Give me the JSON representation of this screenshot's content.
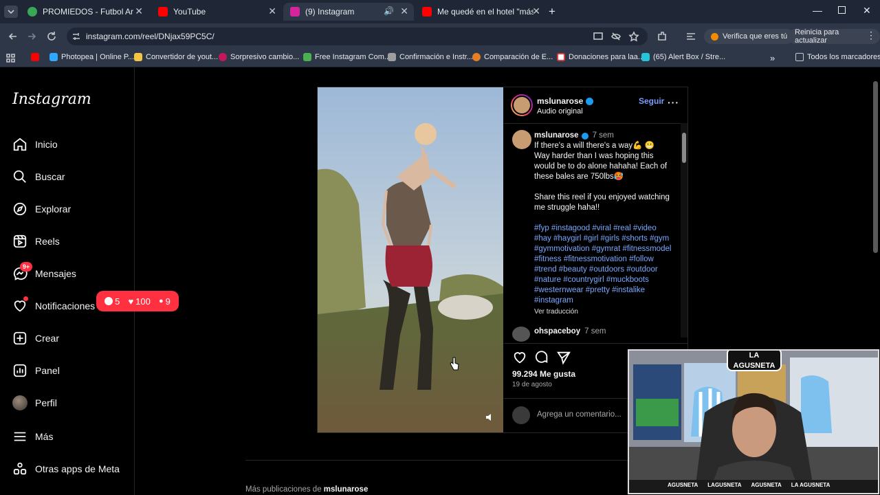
{
  "tabs": [
    {
      "title": "PROMIEDOS - Futbol Argentino",
      "color": "#3aa757"
    },
    {
      "title": "YouTube",
      "color": "#ff0000"
    },
    {
      "title": "(9) Instagram",
      "color": "#d6249f"
    },
    {
      "title": "Me quedé en el hotel \"más lujo",
      "color": "#ff0000"
    }
  ],
  "url": "instagram.com/reel/DNjax59PC5C/",
  "toolbar": {
    "verify": "Verifica que eres tú",
    "reload": "Reinicia para actualizar"
  },
  "bookmarks": [
    "Photopea | Online P...",
    "Convertidor de yout...",
    "Sorpresivo cambio...",
    "Free Instagram Com...",
    "Confirmación e Instr...",
    "Comparación de E...",
    "Donaciones para laa...",
    "(65) Alert Box / Stre..."
  ],
  "bookmarks_all": "Todos los marcadores",
  "nav": {
    "logo": "Instagram",
    "items": [
      "Inicio",
      "Buscar",
      "Explorar",
      "Reels",
      "Mensajes",
      "Notificaciones",
      "Crear",
      "Panel",
      "Perfil",
      "Más",
      "Otras apps de Meta"
    ],
    "messages_badge": "9+",
    "notif": {
      "comments": "5",
      "likes": "100",
      "follows": "9"
    }
  },
  "post": {
    "username": "mslunarose",
    "audio": "Audio original",
    "follow": "Seguir",
    "caption_user": "mslunarose",
    "caption_time": "7 sem",
    "caption": "If there's a will there's a way💪 😬 Way harder than I was hoping this would be to do alone hahaha! Each of these bales are 750lbs🥵",
    "caption2": "Share this reel if you enjoyed watching me struggle haha!!",
    "hashtags": "#fyp #instagood #viral #real #video #hay #haygirl #girl #girls #shorts #gym #gymmotivation #gymrat #fitnessmodel #fitness #fitnessmotivation #follow #trend #beauty #outdoors #outdoor #nature #countrygirl #muckboots #westernwear #pretty #instalike #instagram",
    "translate": "Ver traducción",
    "comment_user": "ohspaceboy",
    "comment_time": "7 sem",
    "likes": "99.294 Me gusta",
    "date": "19 de agosto",
    "add_comment": "Agrega un comentario..."
  },
  "more_posts_prefix": "Más publicaciones de",
  "more_posts_user": "mslunarose",
  "webcam": {
    "logo": "LA AGUSNETA",
    "handles": [
      "AGUSNETA",
      "LAGUSNETA",
      "AGUSNETA",
      "LA AGUSNETA"
    ]
  }
}
